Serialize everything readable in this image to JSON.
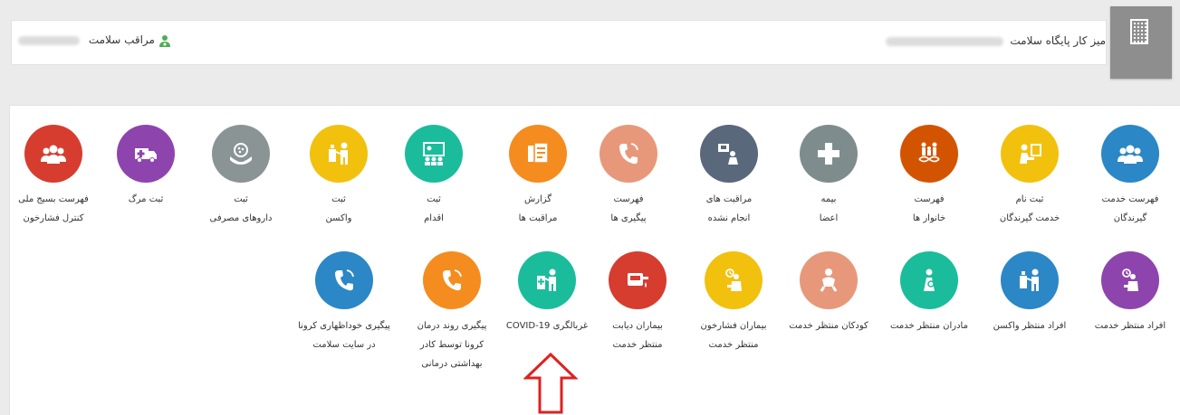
{
  "header": {
    "title": "میز کار پایگاه سلامت",
    "role": "مراقب سلامت"
  },
  "icons": {
    "building": "building-icon",
    "user": "health-worker-icon"
  },
  "row1": [
    {
      "name": "fehrest-khedmat",
      "label1": "فهرست خدمت",
      "label2": "گیرندگان",
      "color": "#2b87c6",
      "icon": "people-group-icon"
    },
    {
      "name": "sabtenam",
      "label1": "ثبت نام",
      "label2": "خدمت گیرندگان",
      "color": "#f2c10e",
      "icon": "person-register-icon"
    },
    {
      "name": "khanevar",
      "label1": "فهرست",
      "label2": "خانوار ها",
      "color": "#d35400",
      "icon": "family-dna-icon"
    },
    {
      "name": "bime",
      "label1": "بیمه",
      "label2": "اعضا",
      "color": "#7f8c8d",
      "icon": "plus-cross-icon"
    },
    {
      "name": "moraghebat-anjam",
      "label1": "مراقبت های",
      "label2": "انجام نشده",
      "color": "#59687a",
      "icon": "undone-care-icon"
    },
    {
      "name": "peygiri",
      "label1": "فهرست",
      "label2": "پیگیری ها",
      "color": "#e8987a",
      "icon": "phone-icon"
    },
    {
      "name": "gozaresh",
      "label1": "گزارش",
      "label2": "مراقبت ها",
      "color": "#f58c1f",
      "icon": "report-icon"
    },
    {
      "name": "eghdam",
      "label1": "ثبت",
      "label2": "اقدام",
      "color": "#1abc9c",
      "icon": "action-board-icon"
    },
    {
      "name": "vaksan",
      "label1": "ثبت",
      "label2": "واکسن",
      "color": "#f2c10e",
      "icon": "vaccine-icon"
    },
    {
      "name": "darooha",
      "label1": "ثبت",
      "label2": "داروهای مصرفی",
      "color": "#8a9494",
      "icon": "medicine-hands-icon"
    },
    {
      "name": "marg",
      "label1": "ثبت مرگ",
      "label2": "",
      "color": "#8e44ad",
      "icon": "ambulance-icon"
    },
    {
      "name": "basij",
      "label1": "فهرست بسیج ملی",
      "label2": "کنترل فشارخون",
      "color": "#d63d2f",
      "icon": "people-group-icon"
    }
  ],
  "row2": [
    {
      "name": "montazer-khedmat",
      "label1": "افراد منتظر خدمت",
      "label2": "",
      "label3": "",
      "color": "#8e44ad",
      "icon": "waiting-person-icon"
    },
    {
      "name": "montazer-vaksan",
      "label1": "افراد منتظر واکسن",
      "label2": "",
      "label3": "",
      "color": "#2b87c6",
      "icon": "vaccine-icon"
    },
    {
      "name": "madaran",
      "label1": "مادران منتظر خدمت",
      "label2": "",
      "label3": "",
      "color": "#1abc9c",
      "icon": "mother-icon"
    },
    {
      "name": "koodakan",
      "label1": "کودکان منتظر خدمت",
      "label2": "",
      "label3": "",
      "color": "#e8987a",
      "icon": "child-icon"
    },
    {
      "name": "feshar",
      "label1": "بیماران فشارخون",
      "label2": "منتظر خدمت",
      "label3": "",
      "color": "#f2c10e",
      "icon": "waiting-person-icon"
    },
    {
      "name": "dyabet",
      "label1": "بیماران دیابت",
      "label2": "منتظر خدمت",
      "label3": "",
      "color": "#d63d2f",
      "icon": "glucometer-icon"
    },
    {
      "name": "covid",
      "label1": "غربالگری COVID-19",
      "label2": "",
      "label3": "",
      "color": "#1abc9c",
      "icon": "screening-icon"
    },
    {
      "name": "peygiri-corona",
      "label1": "پیگیری روند درمان",
      "label2": "کرونا توسط کادر",
      "label3": "بهداشتی درمانی",
      "color": "#f58c1f",
      "icon": "phone-icon"
    },
    {
      "name": "khodezhari",
      "label1": "پیگیری خوداظهاری کرونا",
      "label2": "در سایت سلامت",
      "label3": "",
      "color": "#2b87c6",
      "icon": "phone-icon"
    }
  ],
  "arrow": {
    "color": "#e02020",
    "icon": "up-arrow-icon"
  }
}
